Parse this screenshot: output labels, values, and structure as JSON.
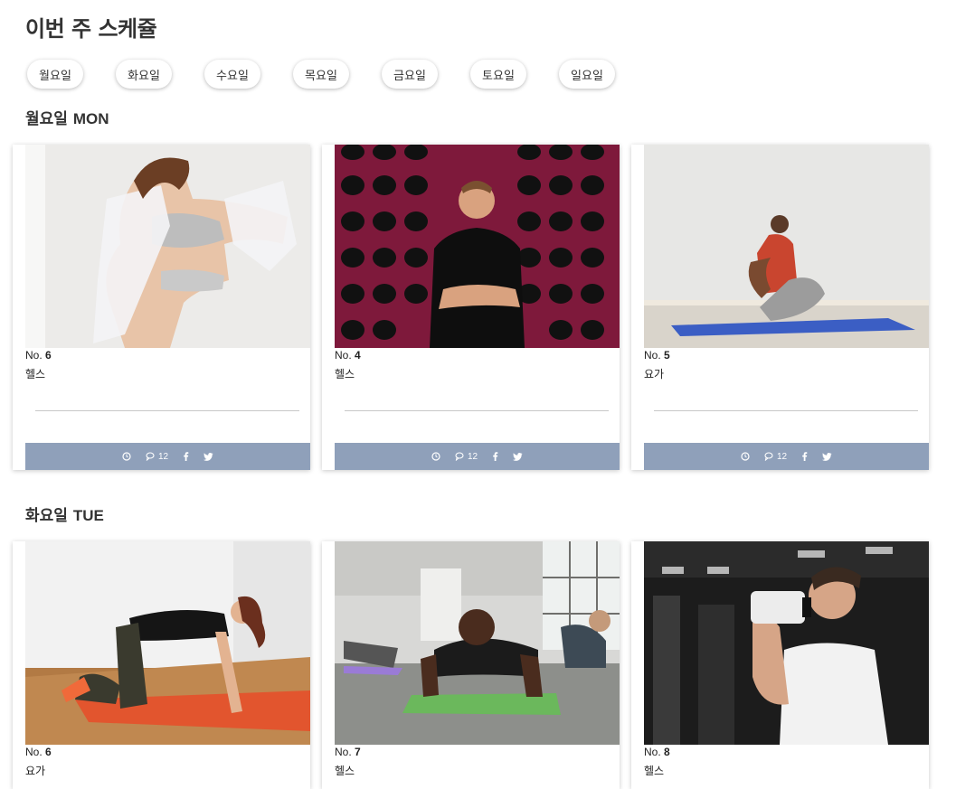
{
  "page": {
    "title": "이번 주 스케쥴"
  },
  "days": [
    "월요일",
    "화요일",
    "수요일",
    "목요일",
    "금요일",
    "토요일",
    "일요일"
  ],
  "sections": [
    {
      "day": "월요일",
      "day_en": "MON",
      "cards": [
        {
          "no_label": "No.",
          "no": "6",
          "category": "헬스",
          "comments": "12"
        },
        {
          "no_label": "No.",
          "no": "4",
          "category": "헬스",
          "comments": "12"
        },
        {
          "no_label": "No.",
          "no": "5",
          "category": "요가",
          "comments": "12"
        }
      ]
    },
    {
      "day": "화요일",
      "day_en": "TUE",
      "cards": [
        {
          "no_label": "No.",
          "no": "6",
          "category": "요가"
        },
        {
          "no_label": "No.",
          "no": "7",
          "category": "헬스"
        },
        {
          "no_label": "No.",
          "no": "8",
          "category": "헬스"
        }
      ]
    }
  ],
  "icons": {
    "clock": "clock-icon",
    "comment": "comments-icon",
    "facebook": "facebook-icon",
    "twitter": "twitter-icon"
  },
  "colors": {
    "action_bar": "#8fa0ba"
  }
}
